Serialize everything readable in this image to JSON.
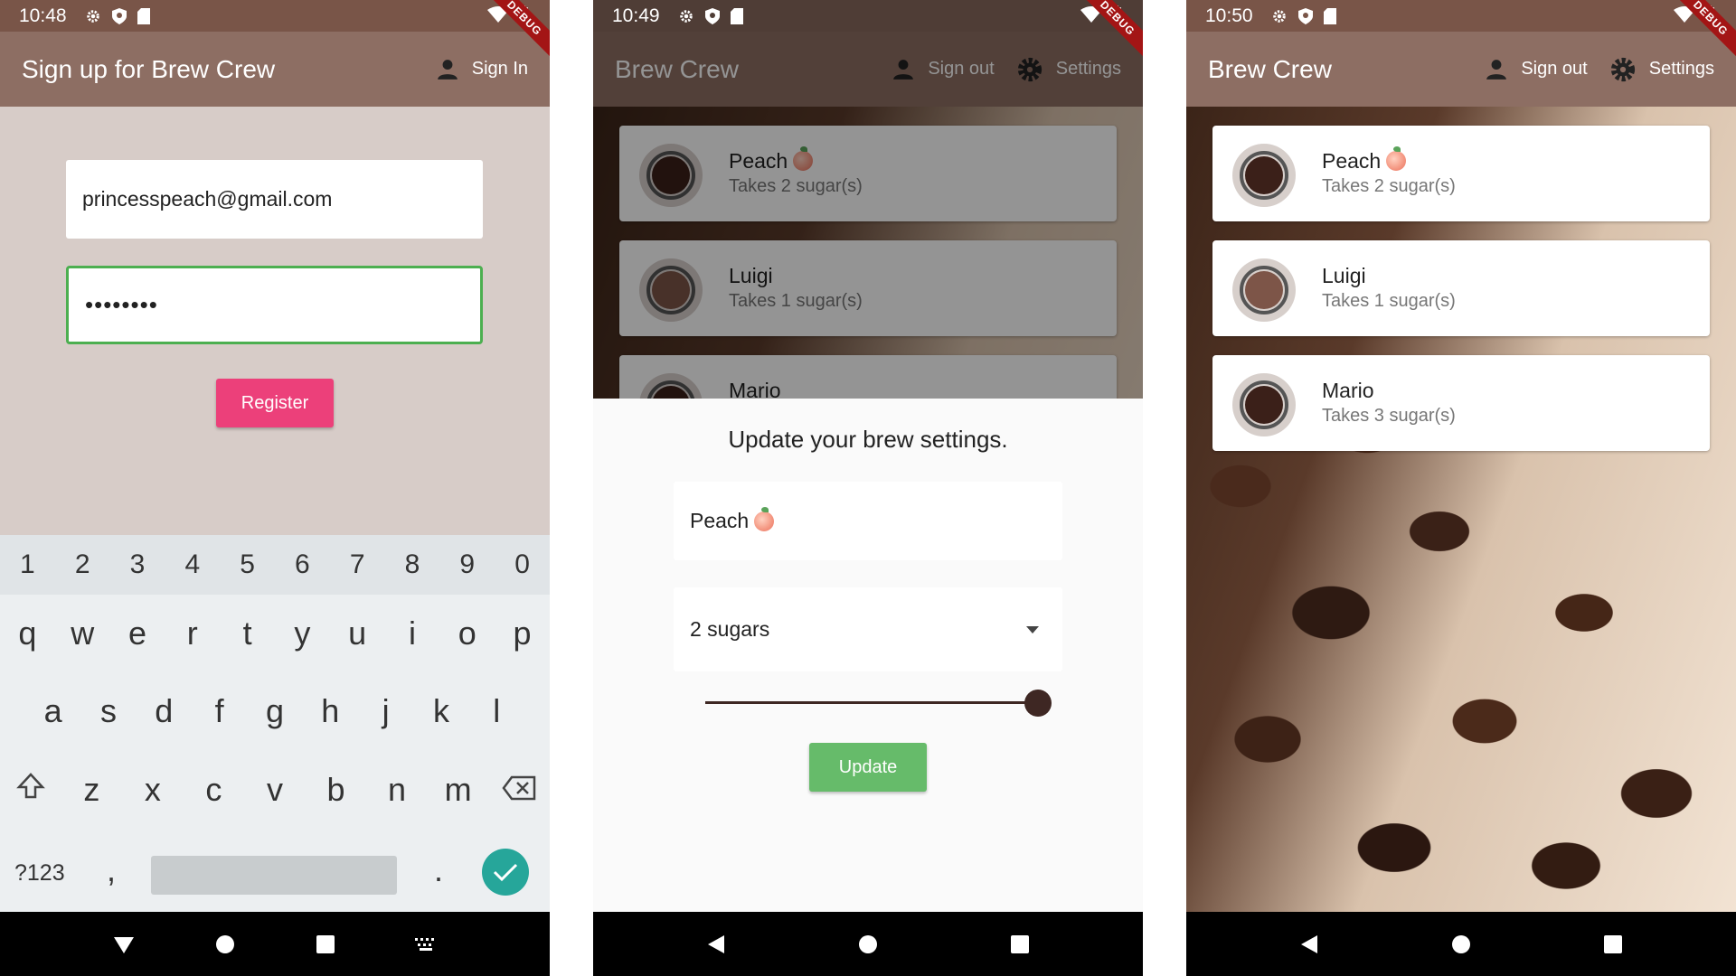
{
  "screens": [
    {
      "time": "10:48",
      "debug": "DEBUG",
      "appbar": {
        "title": "Sign up for Brew Crew",
        "action_label": "Sign In"
      },
      "email_value": "princesspeach@gmail.com",
      "password_value": "••••••••",
      "register_label": "Register",
      "keyboard": {
        "numbers": [
          "1",
          "2",
          "3",
          "4",
          "5",
          "6",
          "7",
          "8",
          "9",
          "0"
        ],
        "row1": [
          "q",
          "w",
          "e",
          "r",
          "t",
          "y",
          "u",
          "i",
          "o",
          "p"
        ],
        "row2": [
          "a",
          "s",
          "d",
          "f",
          "g",
          "h",
          "j",
          "k",
          "l"
        ],
        "row3": [
          "z",
          "x",
          "c",
          "v",
          "b",
          "n",
          "m"
        ],
        "symbols": "?123",
        "comma": ",",
        "period": "."
      }
    },
    {
      "time": "10:49",
      "debug": "DEBUG",
      "appbar": {
        "title": "Brew Crew",
        "signout_label": "Sign out",
        "settings_label": "Settings"
      },
      "brews": [
        {
          "name": "Peach",
          "sub": "Takes 2 sugar(s)",
          "coffee_color": "#3b2019"
        },
        {
          "name": "Luigi",
          "sub": "Takes 1 sugar(s)",
          "coffee_color": "#7d5548"
        },
        {
          "name": "Mario",
          "sub": "",
          "coffee_color": "#3b2019"
        }
      ],
      "sheet": {
        "heading": "Update your brew settings.",
        "name_value": "Peach",
        "sugars_value": "2 sugars",
        "strength_level": 1.0,
        "update_label": "Update"
      }
    },
    {
      "time": "10:50",
      "debug": "DEBUG",
      "appbar": {
        "title": "Brew Crew",
        "signout_label": "Sign out",
        "settings_label": "Settings"
      },
      "brews": [
        {
          "name": "Peach",
          "sub": "Takes 2 sugar(s)",
          "coffee_color": "#3b2019"
        },
        {
          "name": "Luigi",
          "sub": "Takes 1 sugar(s)",
          "coffee_color": "#7d5548"
        },
        {
          "name": "Mario",
          "sub": "Takes 3 sugar(s)",
          "coffee_color": "#3b2019"
        }
      ]
    }
  ],
  "colors": {
    "appbar": "#8d6e63",
    "register": "#ec407a",
    "update": "#66bb6a",
    "focus": "#4caf50"
  }
}
